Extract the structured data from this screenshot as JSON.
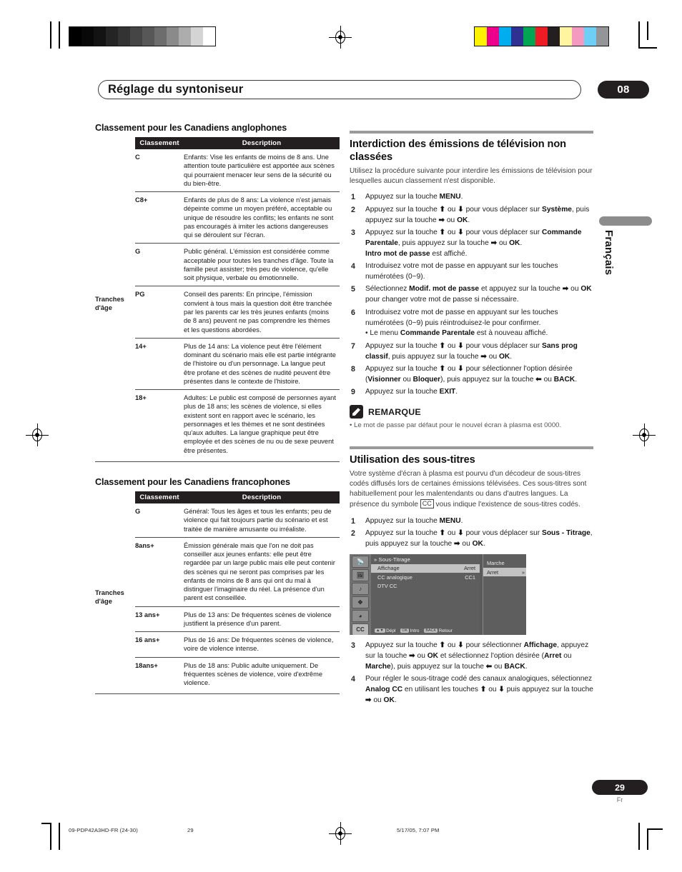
{
  "header": {
    "chapter_title": "Réglage du syntoniseur",
    "chapter_number": "08",
    "side_language": "Français"
  },
  "left_column": {
    "table_anglophones": {
      "heading": "Classement pour les Canadiens anglophones",
      "columns": [
        "",
        "Classement",
        "Description"
      ],
      "age_group_label": "Tranches d'âge",
      "rows": [
        {
          "code": "C",
          "description": "Enfants: Vise les enfants de moins de 8 ans. Une attention toute particulière est apportée aux scènes qui pourraient menacer leur sens de la sécurité ou du bien-être."
        },
        {
          "code": "C8+",
          "description": "Enfants de plus de 8 ans: La violence n'est jamais dépeinte comme un moyen préféré, acceptable ou unique de résoudre les conflits; les enfants ne sont pas encouragés à imiter les actions dangereuses qui se déroulent sur l'écran."
        },
        {
          "code": "G",
          "description": "Public général. L'émission est considérée comme acceptable pour toutes les tranches d'âge. Toute la famille peut assister; très peu de violence, qu'elle soit physique, verbale ou émotionnelle."
        },
        {
          "code": "PG",
          "description": "Conseil des parents: En principe, l'émission convient à tous mais la question doit être tranchée par les parents car les très jeunes enfants (moins de 8 ans) peuvent ne pas comprendre les thèmes et les questions abordées."
        },
        {
          "code": "14+",
          "description": "Plus de 14 ans: La violence peut être l'élément dominant du scénario mais elle est partie intégrante de l'histoire ou d'un personnage. La langue peut être profane et des scènes de nudité peuvent être présentes dans le contexte de l'histoire."
        },
        {
          "code": "18+",
          "description": "Adultes: Le public est composé de personnes ayant plus de 18 ans; les scènes de violence, si elles existent sont en rapport avec le scénario, les personnages et les thèmes et ne sont destinées qu'aux adultes. La langue graphique peut être employée et des scènes de nu ou de sexe peuvent être présentes."
        }
      ]
    },
    "table_francophones": {
      "heading": "Classement pour les Canadiens francophones",
      "columns": [
        "",
        "Classement",
        "Description"
      ],
      "age_group_label": "Tranches d'âge",
      "rows": [
        {
          "code": "G",
          "description": "Général: Tous les âges et tous les enfants; peu de violence qui fait toujours partie du scénario et est traitée de manière amusante ou irréaliste."
        },
        {
          "code": "8ans+",
          "description": "Émission générale mais que l'on ne doit pas conseiller aux jeunes enfants: elle peut être regardée par un large public mais elle peut contenir des scènes qui ne seront pas comprises par les enfants de moins de 8 ans qui ont du mal à distinguer l'imaginaire du réel. La présence d'un parent est conseillée."
        },
        {
          "code": "13 ans+",
          "description": "Plus de 13 ans: De fréquentes scènes de violence justifient la présence d'un parent."
        },
        {
          "code": "16 ans+",
          "description": "Plus de 16 ans: De fréquentes scènes de violence, voire de violence intense."
        },
        {
          "code": "18ans+",
          "description": "Plus de 18 ans: Public adulte uniquement. De fréquentes scènes de violence, voire d'extrême violence."
        }
      ]
    }
  },
  "right_column": {
    "section1": {
      "heading": "Interdiction des émissions de télévision non classées",
      "intro": "Utilisez la procédure suivante pour interdire les émissions de télévision pour lesquelles aucun classement n'est disponible.",
      "steps": [
        {
          "num": "1",
          "html": "Appuyez sur la touche <span class=\"b\">MENU</span>."
        },
        {
          "num": "2",
          "html": "Appuyez sur la touche <span class=\"b\">&#11014;</span> ou <span class=\"b\">&#11015;</span> pour vous déplacer sur <span class=\"b\">Système</span>, puis appuyez sur la touche <span class=\"b\">&#10145;</span> ou <span class=\"b\">OK</span>."
        },
        {
          "num": "3",
          "html": "Appuyez sur la touche <span class=\"b\">&#11014;</span> ou <span class=\"b\">&#11015;</span> pour vous déplacer sur <span class=\"b\">Commande Parentale</span>, puis appuyez sur la touche <span class=\"b\">&#10145;</span> ou <span class=\"b\">OK</span>.<br><span class=\"b\">Intro mot de passe</span> est affiché."
        },
        {
          "num": "4",
          "html": "Introduisez votre mot de passe en appuyant sur les touches numérotées (0~9)."
        },
        {
          "num": "5",
          "html": "Sélectionnez <span class=\"b\">Modif. mot de passe</span> et appuyez sur la touche <span class=\"b\">&#10145;</span> ou <span class=\"b\">OK</span> pour changer votre mot de passe si nécessaire."
        },
        {
          "num": "6",
          "html": "Introduisez votre mot de passe en appuyant sur les touches numérotées (0~9) puis réintroduisez-le pour confirmer.<span class=\"sub-bullet\">• Le menu <span class=\"b\">Commande Parentale</span> est à nouveau affiché.</span>"
        },
        {
          "num": "7",
          "html": "Appuyez sur la touche <span class=\"b\">&#11014;</span> ou <span class=\"b\">&#11015;</span> pour vous déplacer sur <span class=\"b\">Sans prog classif</span>, puis appuyez sur la touche <span class=\"b\">&#10145;</span> ou <span class=\"b\">OK</span>."
        },
        {
          "num": "8",
          "html": "Appuyez sur la touche <span class=\"b\">&#11014;</span> ou <span class=\"b\">&#11015;</span> pour sélectionner l'option désirée (<span class=\"b\">Visionner</span> ou <span class=\"b\">Bloquer</span>), puis appuyez sur la touche <span class=\"b\">&#11013;</span> ou <span class=\"b\">BACK</span>."
        },
        {
          "num": "9",
          "html": "Appuyez sur la touche <span class=\"b\">EXIT</span>."
        }
      ],
      "remark": {
        "title": "REMARQUE",
        "icon": "pencil-icon",
        "items": [
          "• Le mot de passe par défaut pour le nouvel écran à plasma est 0000."
        ]
      }
    },
    "section2": {
      "heading": "Utilisation des sous-titres",
      "intro_html": "Votre système d'écran à plasma est pourvu d'un décodeur de sous-titres codés diffusés lors de certaines émissions télévisées. Ces sous-titres sont habituellement pour les malentendants ou dans d'autres langues. La présence du symbole <span class=\"cc-box\">CC</span> vous indique l'existence de sous-titres codés.",
      "steps_before_osd": [
        {
          "num": "1",
          "html": "Appuyez sur la touche <span class=\"b\">MENU</span>."
        },
        {
          "num": "2",
          "html": "Appuyez sur la touche <span class=\"b\">&#11014;</span> ou <span class=\"b\">&#11015;</span> pour vous déplacer sur <span class=\"b\">Sous - Titrage</span>, puis appuyez sur la touche <span class=\"b\">&#10145;</span> ou <span class=\"b\">OK</span>."
        }
      ],
      "osd": {
        "title": "Sous-Titrage",
        "rows": [
          {
            "label": "Affichage",
            "value": "Arret",
            "highlighted": true
          },
          {
            "label": "CC analogique",
            "value": "CC1",
            "highlighted": false
          },
          {
            "label": "DTV CC",
            "value": "",
            "highlighted": false
          }
        ],
        "submenu": [
          {
            "label": "Marche",
            "value": "",
            "highlighted": false
          },
          {
            "label": "Arret",
            "value": "»",
            "highlighted": true
          }
        ],
        "footer": [
          {
            "keys": "▲▼",
            "label": "Dépl"
          },
          {
            "keys": "OK",
            "label": "Intro"
          },
          {
            "keys": "BACK",
            "label": "Retour"
          }
        ],
        "sidebar_icons": [
          "antenna-icon",
          "picture-icon",
          "sound-icon",
          "setup-icon",
          "timer-icon",
          "cc-icon"
        ]
      },
      "steps_after_osd": [
        {
          "num": "3",
          "html": "Appuyez sur la touche <span class=\"b\">&#11014;</span> ou <span class=\"b\">&#11015;</span> pour sélectionner <span class=\"b\">Affichage</span>, appuyez sur la touche <span class=\"b\">&#10145;</span> ou <span class=\"b\">OK</span> et sélectionnez l'option désirée (<span class=\"b\">Arret</span> ou <span class=\"b\">Marche</span>), puis appuyez sur la touche <span class=\"b\">&#11013;</span> ou <span class=\"b\">BACK</span>."
        },
        {
          "num": "4",
          "html": "Pour régler le sous-titrage codé des canaux analogiques, sélectionnez <span class=\"b\">Analog CC</span> en utilisant les touches <span class=\"b\">&#11014;</span> ou <span class=\"b\">&#11015;</span> puis appuyez sur la touche <span class=\"b\">&#10145;</span> ou <span class=\"b\">OK</span>."
        }
      ]
    }
  },
  "footer": {
    "page_number": "29",
    "page_language": "Fr",
    "file_name": "09-PDP42A3HD-FR (24-30)",
    "file_page": "29",
    "timestamp": "5/17/05, 7:07 PM"
  },
  "print_marks": {
    "grayscale_swatches": [
      "#000000",
      "#080808",
      "#131313",
      "#242424",
      "#333333",
      "#454545",
      "#575757",
      "#6d6d6d",
      "#8a8a8a",
      "#adadad",
      "#d4d4d4",
      "#ffffff"
    ],
    "color_swatches": [
      "#fff200",
      "#ec008c",
      "#00aeef",
      "#2e3192",
      "#00a651",
      "#ed1c24",
      "#231f20",
      "#fff5a0",
      "#f49ac1",
      "#6dcff6",
      "#939598"
    ]
  }
}
